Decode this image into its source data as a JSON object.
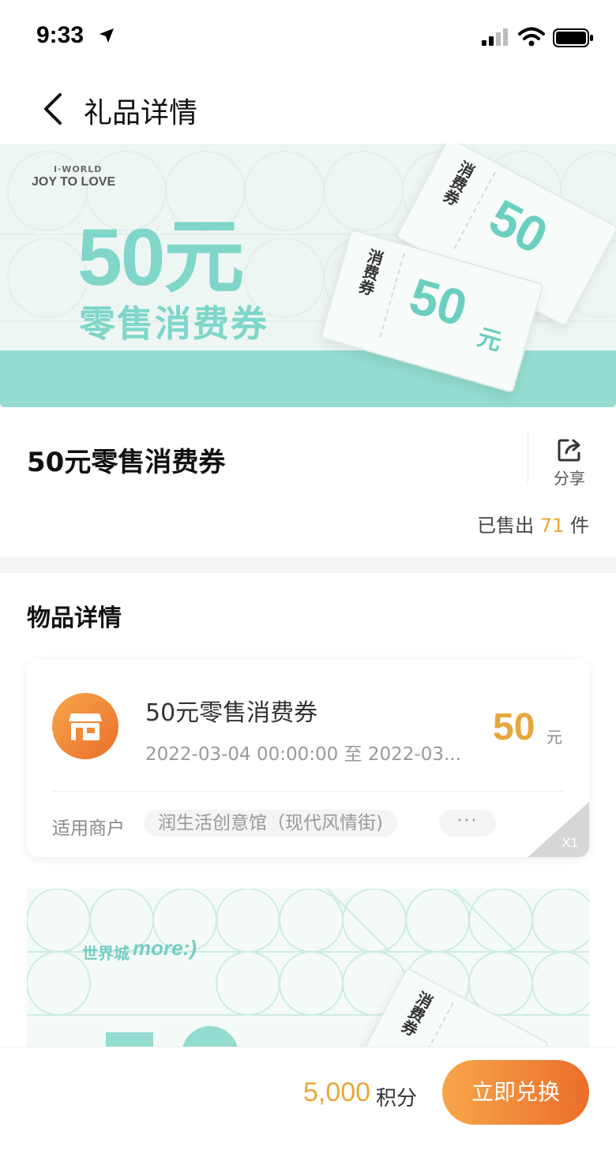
{
  "status_bar": {
    "time": "9:33",
    "icons": [
      "location-arrow-icon",
      "signal-icon",
      "wifi-icon",
      "battery-icon"
    ]
  },
  "nav": {
    "back_icon": "chevron-left-icon",
    "title": "礼品详情"
  },
  "banner": {
    "brand_top": "I·WORLD",
    "brand_main": "JOY TO LOVE",
    "amount": "50元",
    "subtitle": "零售消费券",
    "ticket_label": "消费券",
    "ticket_amount": "50",
    "ticket_unit": "元",
    "ticket_amount_partial": "50"
  },
  "product": {
    "title": "50元零售消费券",
    "share_label": "分享",
    "sold_prefix": "已售出",
    "sold_count": "71",
    "sold_suffix": "件"
  },
  "details": {
    "section_title": "物品详情",
    "card": {
      "title": "50元零售消费券",
      "date_range": "2022-03-04 00:00:00 至 2022-03...",
      "value": "50",
      "unit": "元",
      "merchant_label": "适用商户",
      "merchant_name": "润生活创意馆（现代风情街)",
      "more_label": "···",
      "quantity": "X1"
    }
  },
  "banner2": {
    "logo_cn": "世界城",
    "logo_en": "more:)",
    "ticket_label": "消费券"
  },
  "bottom_bar": {
    "points": "5,000",
    "points_unit": "积分",
    "redeem_label": "立即兑换"
  },
  "colors": {
    "accent_orange": "#e8a73b",
    "button_gradient_start": "#f6a64a",
    "button_gradient_end": "#ea6e2a",
    "mint": "#7fd6c9"
  }
}
